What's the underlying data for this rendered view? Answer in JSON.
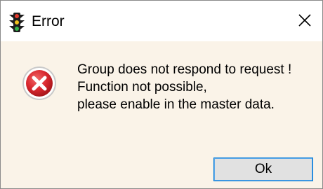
{
  "dialog": {
    "title": "Error",
    "icon": "traffic-light-icon",
    "close_icon": "close-icon"
  },
  "message": {
    "icon": "error-icon",
    "lines": [
      "Group does not respond to request !",
      "Function not possible,",
      "please enable in the master data."
    ]
  },
  "buttons": {
    "ok_label": "Ok"
  },
  "colors": {
    "error_red": "#d9272e",
    "button_border": "#0078d7",
    "content_bg": "#faf3e8"
  }
}
